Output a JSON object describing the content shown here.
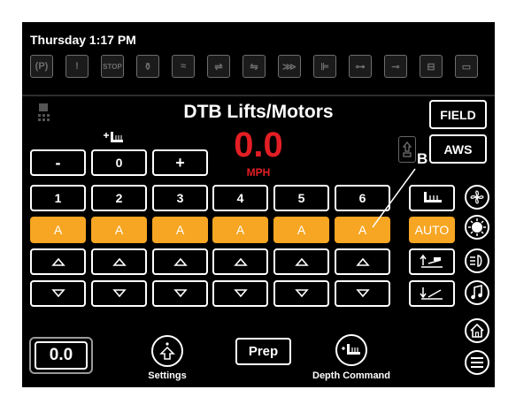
{
  "header": {
    "datetime": "Thursday 1:17 PM"
  },
  "warning_icons": [
    {
      "name": "parking-brake-icon",
      "glyph": "(P)"
    },
    {
      "name": "warning-icon",
      "glyph": "!"
    },
    {
      "name": "stop-icon",
      "glyph": "STOP"
    },
    {
      "name": "hydraulic-oil-icon",
      "glyph": "⚱"
    },
    {
      "name": "coolant-temp-icon",
      "glyph": "≈"
    },
    {
      "name": "fuel-filter-icon",
      "glyph": "⇌"
    },
    {
      "name": "engine-filter-icon",
      "glyph": "⇋"
    },
    {
      "name": "air-filter-icon",
      "glyph": "⋙"
    },
    {
      "name": "transmission-icon",
      "glyph": "⊫"
    },
    {
      "name": "engine-oil-pressure-icon",
      "glyph": "⊶"
    },
    {
      "name": "oil-level-icon",
      "glyph": "⊸"
    },
    {
      "name": "battery-icon",
      "glyph": "⊟"
    },
    {
      "name": "def-icon",
      "glyph": "▭"
    }
  ],
  "page": {
    "title": "DTB Lifts/Motors"
  },
  "speed": {
    "value": "0.0",
    "unit": "MPH"
  },
  "depth_control": {
    "minus": "-",
    "value": "0",
    "plus": "+"
  },
  "rows": {
    "numbers": [
      "1",
      "2",
      "3",
      "4",
      "5",
      "6"
    ],
    "modes": [
      "A",
      "A",
      "A",
      "A",
      "A",
      "A"
    ]
  },
  "right_buttons": {
    "field": "FIELD",
    "aws": "AWS",
    "auto": "AUTO"
  },
  "bottom": {
    "readout": "0.0",
    "settings_label": "Settings",
    "prep_label": "Prep",
    "depth_command_label": "Depth Command"
  },
  "callout": {
    "letter": "B"
  },
  "colors": {
    "accent": "#f6a623",
    "speed": "#e31e24",
    "background": "#000000"
  }
}
